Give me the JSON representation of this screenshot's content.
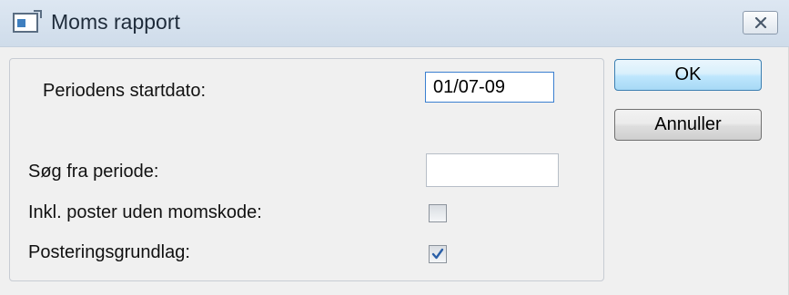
{
  "window": {
    "title": "Moms rapport",
    "close_icon": "close-icon",
    "app_icon": "window-app-icon"
  },
  "form": {
    "start_date": {
      "label": "Periodens startdato:",
      "value": "01/07-09"
    },
    "search_period": {
      "label": "Søg fra periode:",
      "value": ""
    },
    "include_no_vat_code": {
      "label": "Inkl. poster uden momskode:",
      "checked": false
    },
    "posting_basis": {
      "label": "Posteringsgrundlag:",
      "checked": true
    }
  },
  "buttons": {
    "ok_label": "OK",
    "cancel_label": "Annuller"
  },
  "colors": {
    "titlebar": "#d6e2ef",
    "ok_border": "#3c7fb1",
    "focus_border": "#3a7fd0",
    "checkmark": "#2a5fa8"
  }
}
